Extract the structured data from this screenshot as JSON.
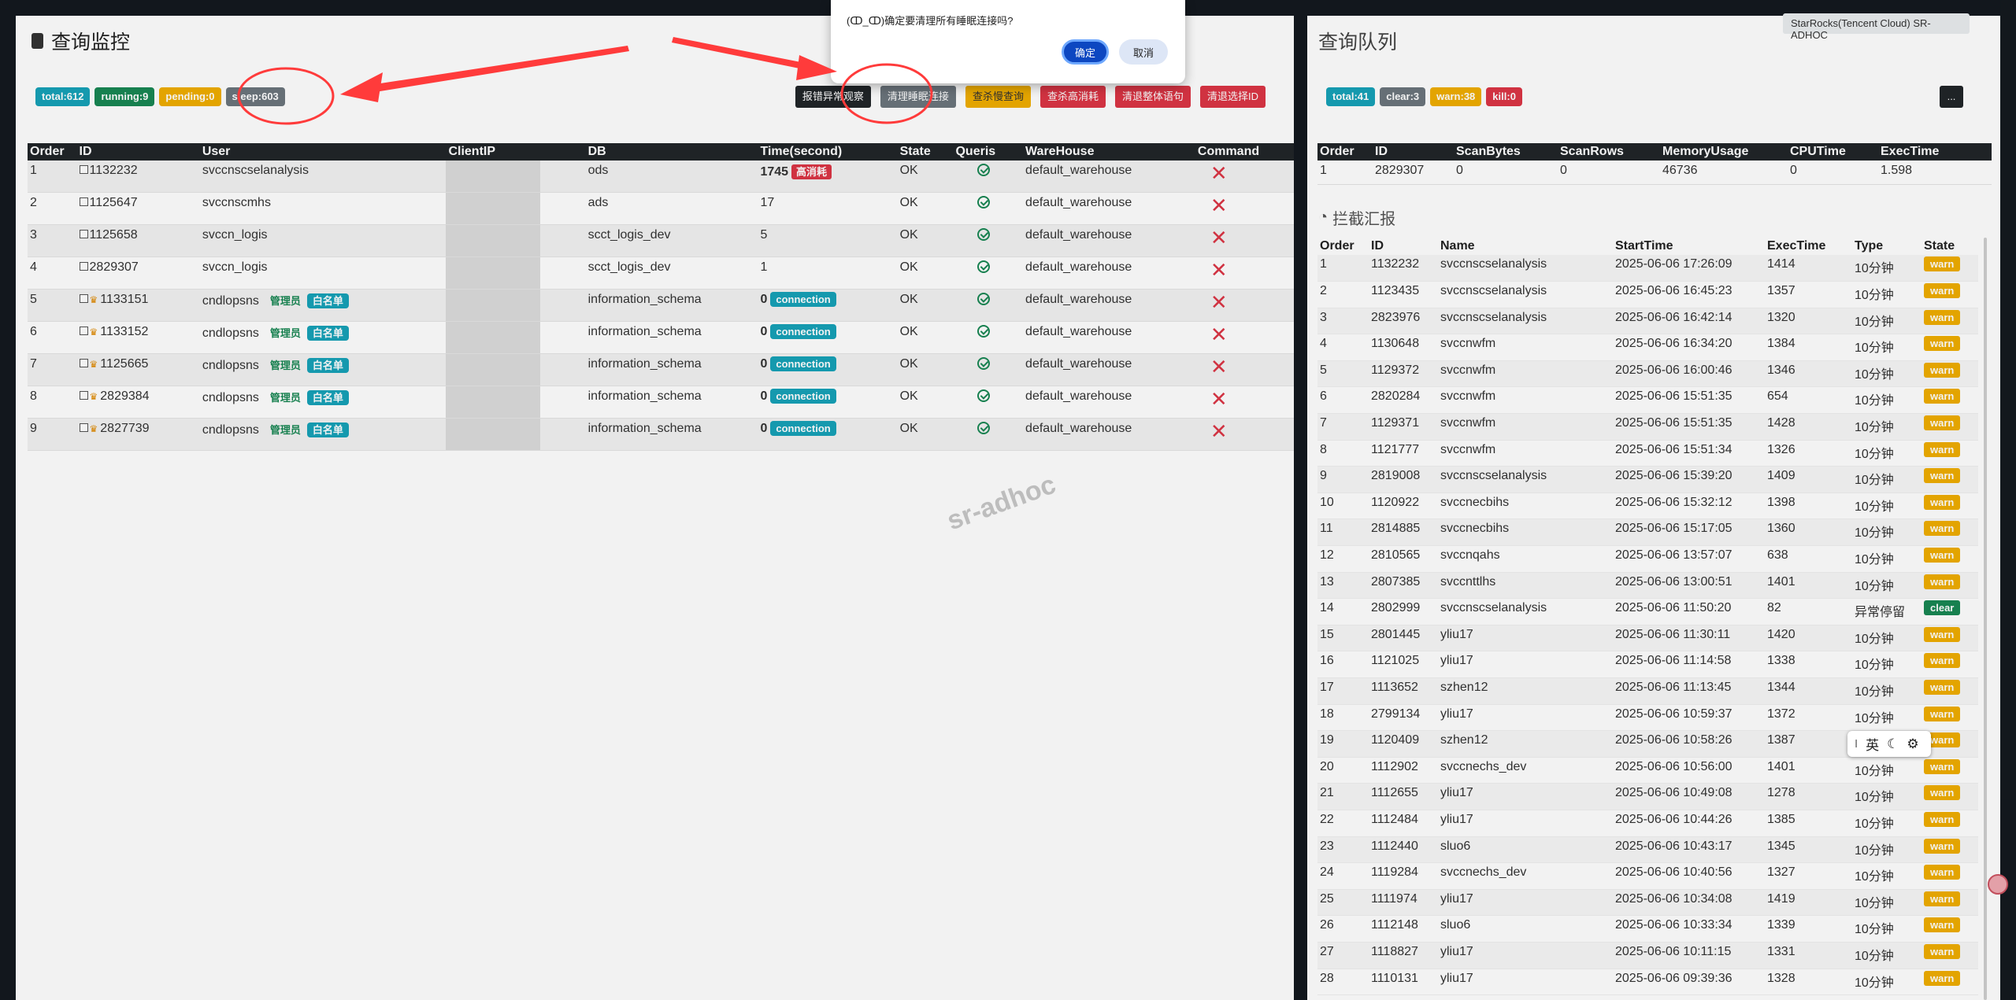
{
  "cluster": "StarRocks(Tencent Cloud) SR-ADHOC",
  "watermark": "sr-adhoc",
  "monitor": {
    "title": "查询监控",
    "badges": [
      "total:612",
      "running:9",
      "pending:0",
      "sleep:603"
    ],
    "actions": [
      "报错异常观察",
      "清理睡眠连接",
      "查杀慢查询",
      "查杀高消耗",
      "清退整体语句",
      "清退选择ID"
    ],
    "columns": [
      "Order",
      "ID",
      "User",
      "ClientIP",
      "DB",
      "Time(second)",
      "State",
      "Queris",
      "WareHouse",
      "Command"
    ],
    "admin_tag": "管理员",
    "whitelist_tag": "白名单",
    "rows": [
      {
        "order": "1",
        "id": "1132232",
        "user": "svccnscselanalysis",
        "db": "ods",
        "time": "1745",
        "time_tag": "高消耗",
        "state": "OK",
        "warehouse": "default_warehouse"
      },
      {
        "order": "2",
        "id": "1125647",
        "user": "svccnscmhs",
        "db": "ads",
        "time": "17",
        "state": "OK",
        "warehouse": "default_warehouse"
      },
      {
        "order": "3",
        "id": "1125658",
        "user": "svccn_logis",
        "db": "scct_logis_dev",
        "time": "5",
        "state": "OK",
        "warehouse": "default_warehouse"
      },
      {
        "order": "4",
        "id": "2829307",
        "user": "svccn_logis",
        "db": "scct_logis_dev",
        "time": "1",
        "state": "OK",
        "warehouse": "default_warehouse"
      },
      {
        "order": "5",
        "id": "1133151",
        "user": "cndlopsns",
        "admin": true,
        "db": "information_schema",
        "time": "0",
        "time_tag": "connection",
        "state": "OK",
        "warehouse": "default_warehouse"
      },
      {
        "order": "6",
        "id": "1133152",
        "user": "cndlopsns",
        "admin": true,
        "db": "information_schema",
        "time": "0",
        "time_tag": "connection",
        "state": "OK",
        "warehouse": "default_warehouse"
      },
      {
        "order": "7",
        "id": "1125665",
        "user": "cndlopsns",
        "admin": true,
        "db": "information_schema",
        "time": "0",
        "time_tag": "connection",
        "state": "OK",
        "warehouse": "default_warehouse"
      },
      {
        "order": "8",
        "id": "2829384",
        "user": "cndlopsns",
        "admin": true,
        "db": "information_schema",
        "time": "0",
        "time_tag": "connection",
        "state": "OK",
        "warehouse": "default_warehouse"
      },
      {
        "order": "9",
        "id": "2827739",
        "user": "cndlopsns",
        "admin": true,
        "db": "information_schema",
        "time": "0",
        "time_tag": "connection",
        "state": "OK",
        "warehouse": "default_warehouse"
      }
    ]
  },
  "queue": {
    "title": "查询队列",
    "badges": [
      "total:41",
      "clear:3",
      "warn:38",
      "kill:0"
    ],
    "more_button": "...",
    "columns": [
      "Order",
      "ID",
      "ScanBytes",
      "ScanRows",
      "MemoryUsage",
      "CPUTime",
      "ExecTime"
    ],
    "rows": [
      {
        "order": "1",
        "id": "2829307",
        "scan_bytes": "0",
        "scan_rows": "0",
        "memory": "46736",
        "cpu": "0",
        "exec": "1.598"
      }
    ]
  },
  "intercept": {
    "title": "拦截汇报",
    "columns": [
      "Order",
      "ID",
      "Name",
      "StartTime",
      "ExecTime",
      "Type",
      "State"
    ],
    "rows": [
      {
        "order": "1",
        "id": "1132232",
        "name": "svccnscselanalysis",
        "start": "2025-06-06 17:26:09",
        "exec": "1414",
        "type": "10分钟",
        "state": "warn"
      },
      {
        "order": "2",
        "id": "1123435",
        "name": "svccnscselanalysis",
        "start": "2025-06-06 16:45:23",
        "exec": "1357",
        "type": "10分钟",
        "state": "warn"
      },
      {
        "order": "3",
        "id": "2823976",
        "name": "svccnscselanalysis",
        "start": "2025-06-06 16:42:14",
        "exec": "1320",
        "type": "10分钟",
        "state": "warn"
      },
      {
        "order": "4",
        "id": "1130648",
        "name": "svccnwfm",
        "start": "2025-06-06 16:34:20",
        "exec": "1384",
        "type": "10分钟",
        "state": "warn"
      },
      {
        "order": "5",
        "id": "1129372",
        "name": "svccnwfm",
        "start": "2025-06-06 16:00:46",
        "exec": "1346",
        "type": "10分钟",
        "state": "warn"
      },
      {
        "order": "6",
        "id": "2820284",
        "name": "svccnwfm",
        "start": "2025-06-06 15:51:35",
        "exec": "654",
        "type": "10分钟",
        "state": "warn"
      },
      {
        "order": "7",
        "id": "1129371",
        "name": "svccnwfm",
        "start": "2025-06-06 15:51:35",
        "exec": "1428",
        "type": "10分钟",
        "state": "warn"
      },
      {
        "order": "8",
        "id": "1121777",
        "name": "svccnwfm",
        "start": "2025-06-06 15:51:34",
        "exec": "1326",
        "type": "10分钟",
        "state": "warn"
      },
      {
        "order": "9",
        "id": "2819008",
        "name": "svccnscselanalysis",
        "start": "2025-06-06 15:39:20",
        "exec": "1409",
        "type": "10分钟",
        "state": "warn"
      },
      {
        "order": "10",
        "id": "1120922",
        "name": "svccnecbihs",
        "start": "2025-06-06 15:32:12",
        "exec": "1398",
        "type": "10分钟",
        "state": "warn"
      },
      {
        "order": "11",
        "id": "2814885",
        "name": "svccnecbihs",
        "start": "2025-06-06 15:17:05",
        "exec": "1360",
        "type": "10分钟",
        "state": "warn"
      },
      {
        "order": "12",
        "id": "2810565",
        "name": "svccnqahs",
        "start": "2025-06-06 13:57:07",
        "exec": "638",
        "type": "10分钟",
        "state": "warn"
      },
      {
        "order": "13",
        "id": "2807385",
        "name": "svccnttlhs",
        "start": "2025-06-06 13:00:51",
        "exec": "1401",
        "type": "10分钟",
        "state": "warn"
      },
      {
        "order": "14",
        "id": "2802999",
        "name": "svccnscselanalysis",
        "start": "2025-06-06 11:50:20",
        "exec": "82",
        "type": "异常停留",
        "state": "clear"
      },
      {
        "order": "15",
        "id": "2801445",
        "name": "yliu17",
        "start": "2025-06-06 11:30:11",
        "exec": "1420",
        "type": "10分钟",
        "state": "warn"
      },
      {
        "order": "16",
        "id": "1121025",
        "name": "yliu17",
        "start": "2025-06-06 11:14:58",
        "exec": "1338",
        "type": "10分钟",
        "state": "warn"
      },
      {
        "order": "17",
        "id": "1113652",
        "name": "szhen12",
        "start": "2025-06-06 11:13:45",
        "exec": "1344",
        "type": "10分钟",
        "state": "warn"
      },
      {
        "order": "18",
        "id": "2799134",
        "name": "yliu17",
        "start": "2025-06-06 10:59:37",
        "exec": "1372",
        "type": "10分钟",
        "state": "warn"
      },
      {
        "order": "19",
        "id": "1120409",
        "name": "szhen12",
        "start": "2025-06-06 10:58:26",
        "exec": "1387",
        "type": "10分钟",
        "state": "warn"
      },
      {
        "order": "20",
        "id": "1112902",
        "name": "svccnechs_dev",
        "start": "2025-06-06 10:56:00",
        "exec": "1401",
        "type": "10分钟",
        "state": "warn"
      },
      {
        "order": "21",
        "id": "1112655",
        "name": "yliu17",
        "start": "2025-06-06 10:49:08",
        "exec": "1278",
        "type": "10分钟",
        "state": "warn"
      },
      {
        "order": "22",
        "id": "1112484",
        "name": "yliu17",
        "start": "2025-06-06 10:44:26",
        "exec": "1385",
        "type": "10分钟",
        "state": "warn"
      },
      {
        "order": "23",
        "id": "1112440",
        "name": "sluo6",
        "start": "2025-06-06 10:43:17",
        "exec": "1345",
        "type": "10分钟",
        "state": "warn"
      },
      {
        "order": "24",
        "id": "1119284",
        "name": "svccnechs_dev",
        "start": "2025-06-06 10:40:56",
        "exec": "1327",
        "type": "10分钟",
        "state": "warn"
      },
      {
        "order": "25",
        "id": "1111974",
        "name": "yliu17",
        "start": "2025-06-06 10:34:08",
        "exec": "1419",
        "type": "10分钟",
        "state": "warn"
      },
      {
        "order": "26",
        "id": "1112148",
        "name": "sluo6",
        "start": "2025-06-06 10:33:34",
        "exec": "1339",
        "type": "10分钟",
        "state": "warn"
      },
      {
        "order": "27",
        "id": "1118827",
        "name": "yliu17",
        "start": "2025-06-06 10:11:15",
        "exec": "1331",
        "type": "10分钟",
        "state": "warn"
      },
      {
        "order": "28",
        "id": "1110131",
        "name": "yliu17",
        "start": "2025-06-06 09:39:36",
        "exec": "1328",
        "type": "10分钟",
        "state": "warn"
      }
    ]
  },
  "dialog": {
    "message": "(ↀ_ↀ)确定要清理所有睡眠连接吗?",
    "ok": "确定",
    "cancel": "取消"
  },
  "ime": {
    "cursor": "I",
    "lang": "英",
    "moon_icon": "☾",
    "gear_icon": "⚙"
  },
  "colors": {
    "cyan": "#17a2b8",
    "green": "#198754",
    "yellow": "#f0ad00",
    "gray": "#6c757d",
    "red": "#dc3545",
    "dark": "#212529",
    "annotation_red": "#ff3b3b"
  }
}
